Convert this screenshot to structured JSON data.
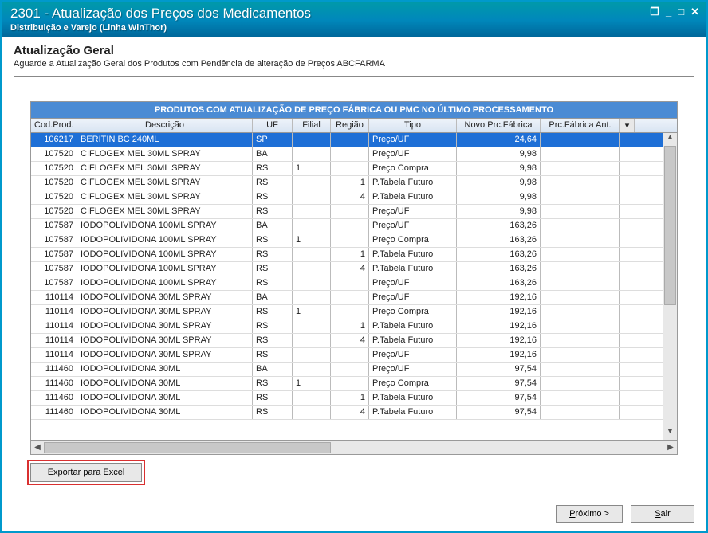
{
  "titlebar": {
    "title": "2301 - Atualização dos Preços dos Medicamentos",
    "subtitle": "Distribuição e Varejo (Linha WinThor)"
  },
  "section": {
    "title": "Atualização Geral",
    "subtitle": "Aguarde a Atualização Geral dos Produtos com Pendência de alteração de Preços ABCFARMA"
  },
  "grid": {
    "band_title": "PRODUTOS COM ATUALIZAÇÃO DE PREÇO FÁBRICA OU PMC NO ÚLTIMO PROCESSAMENTO",
    "columns": {
      "cod": "Cod.Prod.",
      "desc": "Descrição",
      "uf": "UF",
      "filial": "Filial",
      "reg": "Região",
      "tipo": "Tipo",
      "novo": "Novo Prc.Fábrica",
      "ant": "Prc.Fábrica Ant."
    },
    "rows": [
      {
        "cod": "106217",
        "desc": "BERITIN BC 240ML",
        "uf": "SP",
        "filial": "",
        "reg": "",
        "tipo": "Preço/UF",
        "novo": "24,64",
        "ant": "",
        "selected": true
      },
      {
        "cod": "107520",
        "desc": "CIFLOGEX MEL 30ML SPRAY",
        "uf": "BA",
        "filial": "",
        "reg": "",
        "tipo": "Preço/UF",
        "novo": "9,98",
        "ant": ""
      },
      {
        "cod": "107520",
        "desc": "CIFLOGEX MEL 30ML SPRAY",
        "uf": "RS",
        "filial": "1",
        "reg": "",
        "tipo": "Preço Compra",
        "novo": "9,98",
        "ant": ""
      },
      {
        "cod": "107520",
        "desc": "CIFLOGEX MEL 30ML SPRAY",
        "uf": "RS",
        "filial": "",
        "reg": "1",
        "tipo": "P.Tabela Futuro",
        "novo": "9,98",
        "ant": ""
      },
      {
        "cod": "107520",
        "desc": "CIFLOGEX MEL 30ML SPRAY",
        "uf": "RS",
        "filial": "",
        "reg": "4",
        "tipo": "P.Tabela Futuro",
        "novo": "9,98",
        "ant": ""
      },
      {
        "cod": "107520",
        "desc": "CIFLOGEX MEL 30ML SPRAY",
        "uf": "RS",
        "filial": "",
        "reg": "",
        "tipo": "Preço/UF",
        "novo": "9,98",
        "ant": ""
      },
      {
        "cod": "107587",
        "desc": "IODOPOLIVIDONA 100ML SPRAY",
        "uf": "BA",
        "filial": "",
        "reg": "",
        "tipo": "Preço/UF",
        "novo": "163,26",
        "ant": ""
      },
      {
        "cod": "107587",
        "desc": "IODOPOLIVIDONA 100ML SPRAY",
        "uf": "RS",
        "filial": "1",
        "reg": "",
        "tipo": "Preço Compra",
        "novo": "163,26",
        "ant": ""
      },
      {
        "cod": "107587",
        "desc": "IODOPOLIVIDONA 100ML SPRAY",
        "uf": "RS",
        "filial": "",
        "reg": "1",
        "tipo": "P.Tabela Futuro",
        "novo": "163,26",
        "ant": ""
      },
      {
        "cod": "107587",
        "desc": "IODOPOLIVIDONA 100ML SPRAY",
        "uf": "RS",
        "filial": "",
        "reg": "4",
        "tipo": "P.Tabela Futuro",
        "novo": "163,26",
        "ant": ""
      },
      {
        "cod": "107587",
        "desc": "IODOPOLIVIDONA 100ML SPRAY",
        "uf": "RS",
        "filial": "",
        "reg": "",
        "tipo": "Preço/UF",
        "novo": "163,26",
        "ant": ""
      },
      {
        "cod": "110114",
        "desc": "IODOPOLIVIDONA 30ML SPRAY",
        "uf": "BA",
        "filial": "",
        "reg": "",
        "tipo": "Preço/UF",
        "novo": "192,16",
        "ant": ""
      },
      {
        "cod": "110114",
        "desc": "IODOPOLIVIDONA 30ML SPRAY",
        "uf": "RS",
        "filial": "1",
        "reg": "",
        "tipo": "Preço Compra",
        "novo": "192,16",
        "ant": ""
      },
      {
        "cod": "110114",
        "desc": "IODOPOLIVIDONA 30ML SPRAY",
        "uf": "RS",
        "filial": "",
        "reg": "1",
        "tipo": "P.Tabela Futuro",
        "novo": "192,16",
        "ant": ""
      },
      {
        "cod": "110114",
        "desc": "IODOPOLIVIDONA 30ML SPRAY",
        "uf": "RS",
        "filial": "",
        "reg": "4",
        "tipo": "P.Tabela Futuro",
        "novo": "192,16",
        "ant": ""
      },
      {
        "cod": "110114",
        "desc": "IODOPOLIVIDONA 30ML SPRAY",
        "uf": "RS",
        "filial": "",
        "reg": "",
        "tipo": "Preço/UF",
        "novo": "192,16",
        "ant": ""
      },
      {
        "cod": "111460",
        "desc": "IODOPOLIVIDONA 30ML",
        "uf": "BA",
        "filial": "",
        "reg": "",
        "tipo": "Preço/UF",
        "novo": "97,54",
        "ant": ""
      },
      {
        "cod": "111460",
        "desc": "IODOPOLIVIDONA 30ML",
        "uf": "RS",
        "filial": "1",
        "reg": "",
        "tipo": "Preço Compra",
        "novo": "97,54",
        "ant": ""
      },
      {
        "cod": "111460",
        "desc": "IODOPOLIVIDONA 30ML",
        "uf": "RS",
        "filial": "",
        "reg": "1",
        "tipo": "P.Tabela Futuro",
        "novo": "97,54",
        "ant": ""
      },
      {
        "cod": "111460",
        "desc": "IODOPOLIVIDONA 30ML",
        "uf": "RS",
        "filial": "",
        "reg": "4",
        "tipo": "P.Tabela Futuro",
        "novo": "97,54",
        "ant": ""
      }
    ]
  },
  "buttons": {
    "export": "Exportar para Excel",
    "next_prefix": "P",
    "next_rest": "róximo >",
    "exit_prefix": "S",
    "exit_rest": "air"
  }
}
